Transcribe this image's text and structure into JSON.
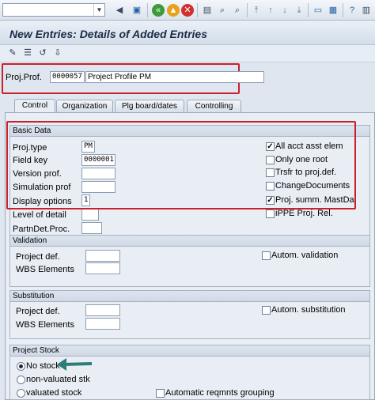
{
  "toolbar": {
    "command_value": ""
  },
  "title": "New Entries: Details of Added Entries",
  "header": {
    "proj_prof_label": "Proj.Prof.",
    "proj_prof_value": "0000057",
    "proj_prof_desc": "Project Profile PM"
  },
  "tabs": [
    "Control",
    "Organization",
    "Plg board/dates",
    "Controlling"
  ],
  "basic_data": {
    "title": "Basic Data",
    "proj_type_label": "Proj.type",
    "proj_type_value": "PM",
    "field_key_label": "Field key",
    "field_key_value": "0000001",
    "version_prof_label": "Version prof.",
    "simulation_prof_label": "Simulation prof",
    "display_options_label": "Display options",
    "display_options_value": "1",
    "level_of_detail_label": "Level of detail",
    "partndet_label": "PartnDet.Proc.",
    "checks": [
      {
        "label": "All acct asst elem",
        "mark": "✓"
      },
      {
        "label": "Only one root",
        "mark": ""
      },
      {
        "label": "Trsfr to proj.def.",
        "mark": ""
      },
      {
        "label": "ChangeDocuments",
        "mark": ""
      },
      {
        "label": "Proj. summ. MastDa",
        "mark": "✓"
      },
      {
        "label": "iPPE Proj. Rel.",
        "mark": ""
      }
    ]
  },
  "validation": {
    "title": "Validation",
    "project_def_label": "Project def.",
    "wbs_label": "WBS Elements",
    "autom_label": "Autom. validation"
  },
  "substitution": {
    "title": "Substitution",
    "project_def_label": "Project def.",
    "wbs_label": "WBS Elements",
    "autom_label": "Autom. substitution"
  },
  "project_stock": {
    "title": "Project Stock",
    "options": [
      "No stock",
      "non-valuated stk",
      "valuated stock"
    ],
    "auto_reqmnts_label": "Automatic reqmnts grouping"
  },
  "colors": {
    "highlight": "#c9212c",
    "arrow": "#2e7d7a"
  }
}
